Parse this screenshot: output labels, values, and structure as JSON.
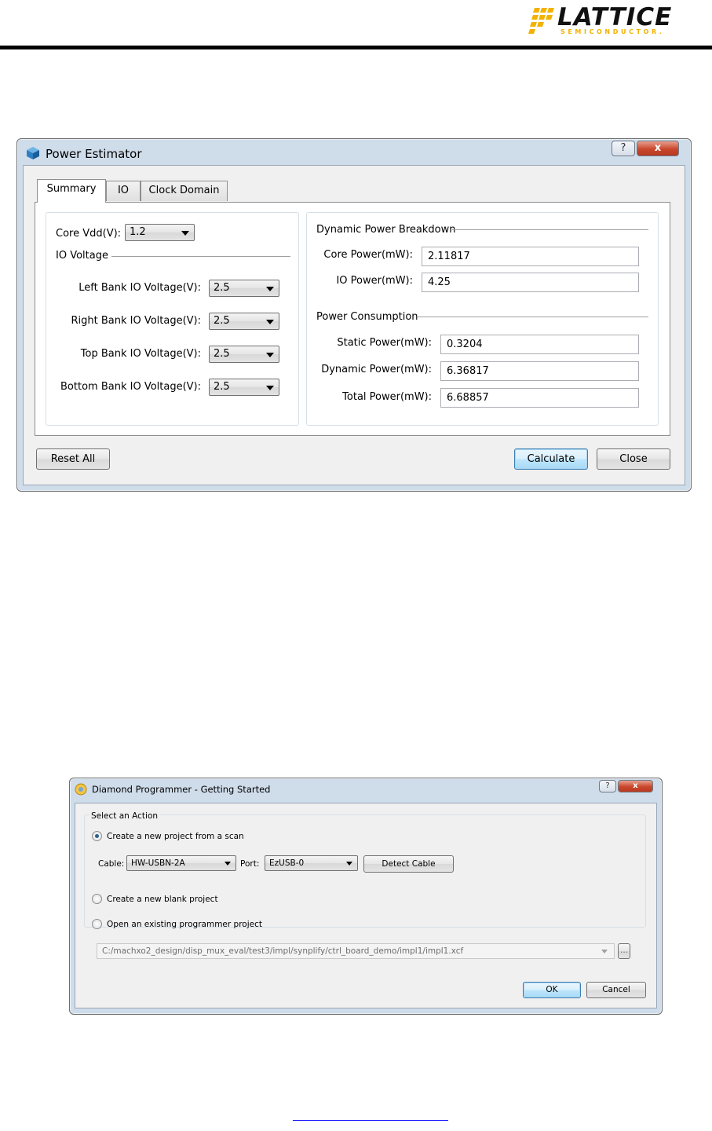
{
  "header": {
    "logo_word": "LATTICE",
    "logo_sub": "SEMICONDUCTOR.",
    "accent": "#f2b200"
  },
  "power_estimator": {
    "title": "Power Estimator",
    "help_glyph": "?",
    "close_glyph": "x",
    "tabs": [
      "Summary",
      "IO",
      "Clock Domain"
    ],
    "active_tab": "Summary",
    "core_vdd_label": "Core Vdd(V):",
    "core_vdd_value": "1.2",
    "io_voltage_heading": "IO Voltage",
    "banks": [
      {
        "label": "Left Bank IO Voltage(V):",
        "value": "2.5"
      },
      {
        "label": "Right Bank IO Voltage(V):",
        "value": "2.5"
      },
      {
        "label": "Top Bank IO Voltage(V):",
        "value": "2.5"
      },
      {
        "label": "Bottom Bank IO Voltage(V):",
        "value": "2.5"
      }
    ],
    "dynamic_heading": "Dynamic Power Breakdown",
    "core_power_label": "Core Power(mW):",
    "core_power_value": "2.11817",
    "io_power_label": "IO Power(mW):",
    "io_power_value": "4.25",
    "consumption_heading": "Power Consumption",
    "static_power_label": "Static Power(mW):",
    "static_power_value": "0.3204",
    "dynamic_power_label": "Dynamic Power(mW):",
    "dynamic_power_value": "6.36817",
    "total_power_label": "Total Power(mW):",
    "total_power_value": "6.68857",
    "reset_label": "Reset All",
    "calculate_label": "Calculate",
    "close_label": "Close"
  },
  "programmer": {
    "title": "Diamond Programmer - Getting Started",
    "help_glyph": "?",
    "close_glyph": "x",
    "group_label": "Select an Action",
    "option_scan": "Create a new project from a scan",
    "cable_label": "Cable:",
    "cable_value": "HW-USBN-2A",
    "port_label": "Port:",
    "port_value": "EzUSB-0",
    "detect_label": "Detect Cable",
    "option_blank": "Create a new blank project",
    "option_open": "Open an existing programmer project",
    "project_path": "C:/machxo2_design/disp_mux_eval/test3/impl/synplify/ctrl_board_demo/impl1/impl1.xcf",
    "browse_label": "...",
    "ok_label": "OK",
    "cancel_label": "Cancel",
    "selected_option": "scan"
  }
}
